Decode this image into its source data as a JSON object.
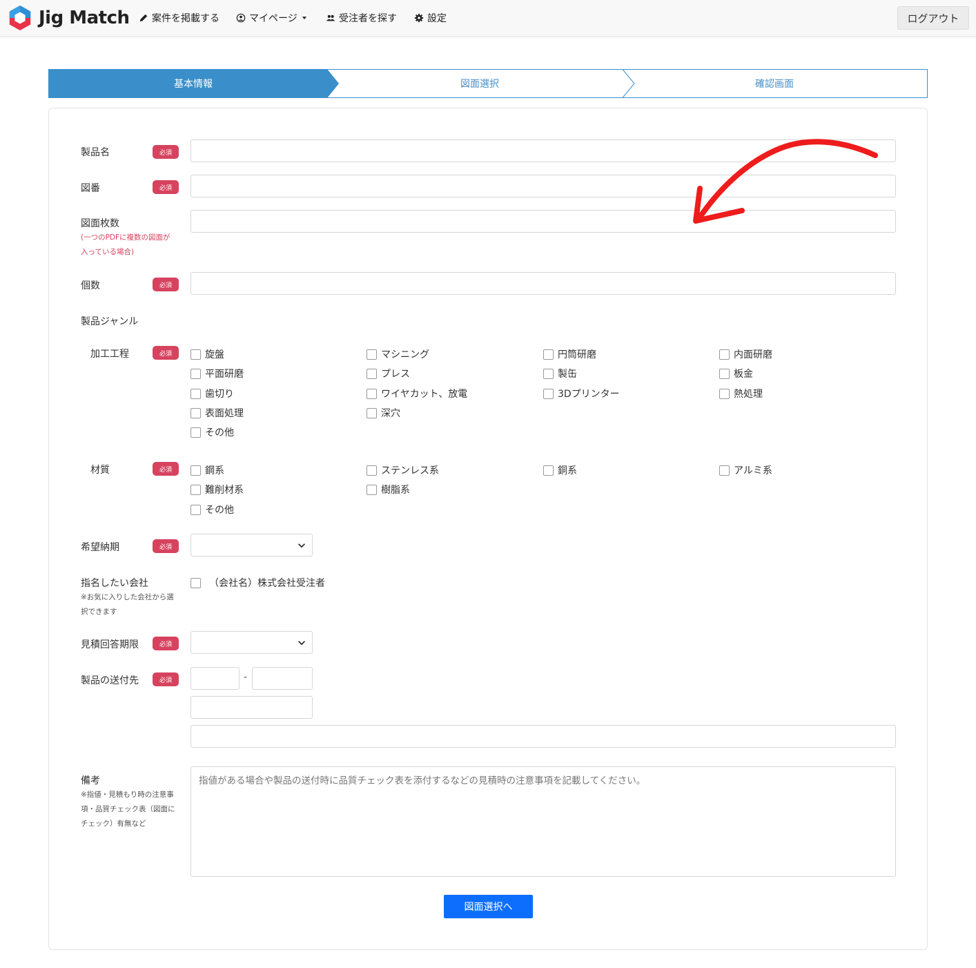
{
  "app": {
    "name": "Jig Match"
  },
  "nav": {
    "post_job": "案件を掲載する",
    "mypage": "マイページ",
    "find_contractor": "受注者を探す",
    "settings": "設定",
    "logout": "ログアウト"
  },
  "steps": [
    "基本情報",
    "図面選択",
    "確認画面"
  ],
  "colors": {
    "step_active": "#3a8fca",
    "required_badge": "#d6435f",
    "primary": "#0d6efd",
    "brand_blue": "#2b8fd6",
    "brand_red": "#e8334a"
  },
  "form": {
    "required_label": "必須",
    "product_name": "製品名",
    "drawing_number": "図番",
    "drawing_count": "図面枚数",
    "drawing_count_note_1": "(一つのPDFに複数の図面が",
    "drawing_count_note_2": "入っている場合)",
    "quantity": "個数",
    "genre": "製品ジャンル",
    "process": "加工工程",
    "process_options": [
      "旋盤",
      "マシニング",
      "円筒研磨",
      "内面研磨",
      "平面研磨",
      "プレス",
      "製缶",
      "板金",
      "歯切り",
      "ワイヤカット、放電",
      "3Dプリンター",
      "熱処理",
      "表面処理",
      "深穴",
      "その他"
    ],
    "material": "材質",
    "material_options": [
      "鋼系",
      "ステンレス系",
      "銅系",
      "アルミ系",
      "難削材系",
      "樹脂系",
      "その他"
    ],
    "delivery": "希望納期",
    "nominate": "指名したい会社",
    "nominate_note_1": "※お気に入りした会社から選",
    "nominate_note_2": "択できます",
    "nominate_company": "（会社名）株式会社受注者",
    "quote_deadline": "見積回答期限",
    "ship_to": "製品の送付先",
    "zip_separator": "-",
    "remarks": "備考",
    "remarks_note_1": "※指値・見積もり時の注意事",
    "remarks_note_2": "項・品質チェック表（図面に",
    "remarks_note_3": "チェック）有無など",
    "remarks_placeholder": "指値がある場合や製品の送付時に品質チェック表を添付するなどの見積時の注意事項を記載してください。",
    "next_button": "図面選択へ"
  }
}
